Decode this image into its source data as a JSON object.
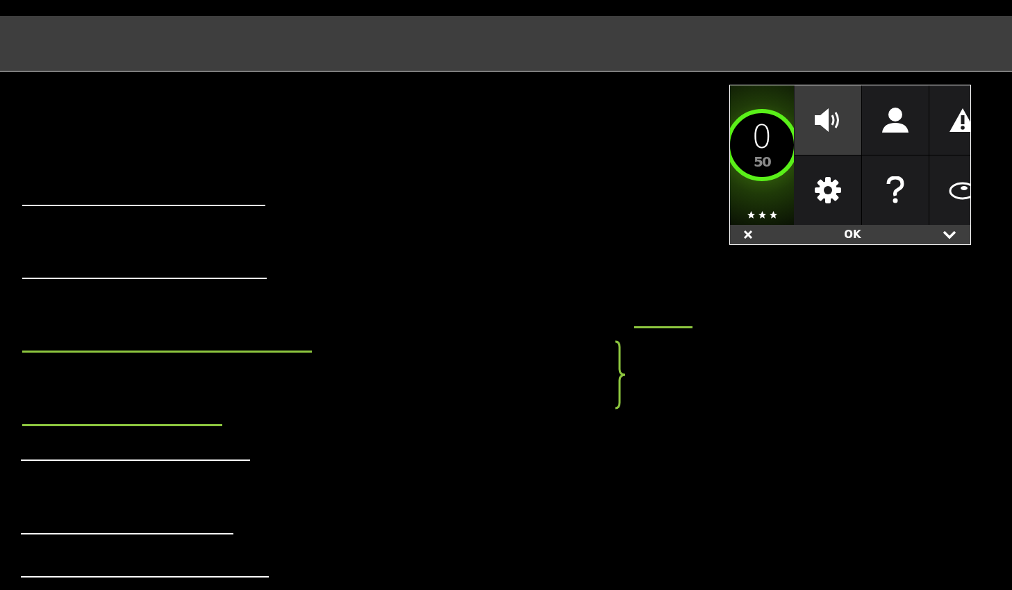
{
  "lines": [
    {
      "color": "#ffffff"
    },
    {
      "color": "#ffffff"
    },
    {
      "color": "#8dc63f"
    },
    {
      "color": "#8dc63f"
    },
    {
      "color": "#ffffff"
    },
    {
      "color": "#ffffff"
    },
    {
      "color": "#ffffff"
    }
  ],
  "device": {
    "score": "0",
    "target": "50",
    "stars": 3,
    "tiles": [
      {
        "kind": "speaker",
        "selected": true
      },
      {
        "kind": "person",
        "selected": false
      },
      {
        "kind": "warning",
        "selected": false
      },
      {
        "kind": "gear",
        "selected": false
      },
      {
        "kind": "question",
        "selected": false
      },
      {
        "kind": "disc",
        "selected": false
      }
    ],
    "ok": "OK"
  }
}
